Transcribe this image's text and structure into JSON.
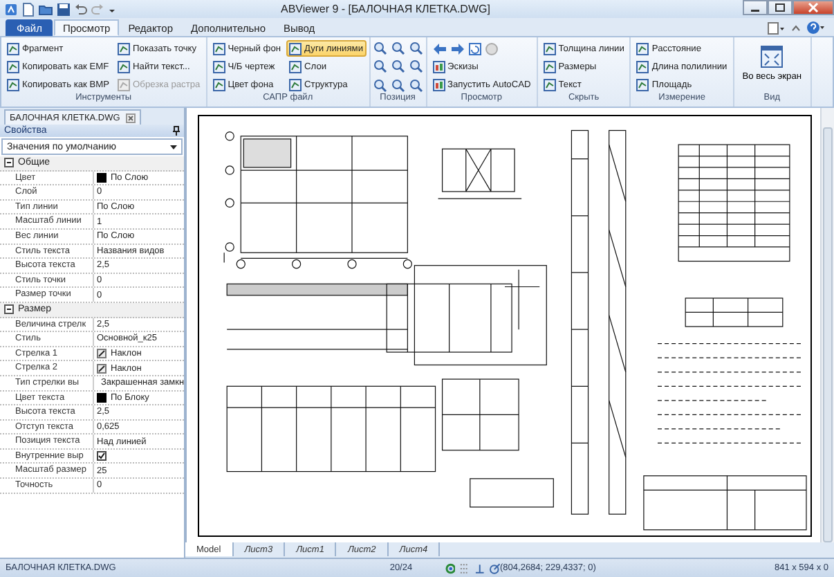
{
  "window": {
    "title": "ABViewer 9 - [БАЛОЧНАЯ КЛЕТКА.DWG]"
  },
  "ribbon_tabs": [
    {
      "label": "Файл",
      "kind": "file",
      "selected": false
    },
    {
      "label": "Просмотр",
      "kind": "tab",
      "selected": true
    },
    {
      "label": "Редактор",
      "kind": "tab",
      "selected": false
    },
    {
      "label": "Дополнительно",
      "kind": "tab",
      "selected": false
    },
    {
      "label": "Вывод",
      "kind": "tab",
      "selected": false
    }
  ],
  "ribbon_groups": [
    {
      "label": "Инструменты",
      "kind": "columns",
      "columns": [
        [
          {
            "label": "Фрагмент",
            "disabled": false,
            "on": false
          },
          {
            "label": "Копировать как EMF",
            "disabled": false,
            "on": false
          },
          {
            "label": "Копировать как BMP",
            "disabled": false,
            "on": false
          }
        ],
        [
          {
            "label": "Показать точку",
            "disabled": false,
            "on": false
          },
          {
            "label": "Найти текст...",
            "disabled": false,
            "on": false
          },
          {
            "label": "Обрезка растра",
            "disabled": true,
            "on": false
          }
        ]
      ]
    },
    {
      "label": "САПР файл",
      "kind": "columns",
      "columns": [
        [
          {
            "label": "Черный фон",
            "disabled": false,
            "on": false
          },
          {
            "label": "Ч/Б чертеж",
            "disabled": false,
            "on": false
          },
          {
            "label": "Цвет фона",
            "disabled": false,
            "on": false
          }
        ],
        [
          {
            "label": "Дуги линиями",
            "disabled": false,
            "on": true
          },
          {
            "label": "Слои",
            "disabled": false,
            "on": false
          },
          {
            "label": "Структура",
            "disabled": false,
            "on": false
          }
        ]
      ]
    },
    {
      "label": "Позиция",
      "kind": "zoom"
    },
    {
      "label": "Просмотр",
      "kind": "nav",
      "columns": [
        [
          {
            "label": "Эскизы",
            "disabled": false,
            "on": false
          },
          {
            "label": "Запустить AutoCAD",
            "disabled": false,
            "on": false
          }
        ]
      ]
    },
    {
      "label": "Скрыть",
      "kind": "columns",
      "columns": [
        [
          {
            "label": "Толщина линии",
            "disabled": false,
            "on": false
          },
          {
            "label": "Размеры",
            "disabled": false,
            "on": false
          },
          {
            "label": "Текст",
            "disabled": false,
            "on": false
          }
        ]
      ]
    },
    {
      "label": "Измерение",
      "kind": "columns",
      "columns": [
        [
          {
            "label": "Расстояние",
            "disabled": false,
            "on": false
          },
          {
            "label": "Длина полилинии",
            "disabled": false,
            "on": false
          },
          {
            "label": "Площадь",
            "disabled": false,
            "on": false
          }
        ]
      ]
    },
    {
      "label": "Вид",
      "kind": "big",
      "columns": [
        [
          {
            "label": "Во весь экран",
            "disabled": false,
            "on": false
          }
        ]
      ]
    }
  ],
  "document_tab": {
    "label": "БАЛОЧНАЯ КЛЕТКА.DWG"
  },
  "properties": {
    "title": "Свойства",
    "preset": "Значения по умолчанию",
    "categories": [
      {
        "label": "Общие",
        "expanded": true,
        "rows": [
          {
            "name": "Цвет",
            "value": "По Слою",
            "kind": "swatch"
          },
          {
            "name": "Слой",
            "value": "0",
            "kind": "text"
          },
          {
            "name": "Тип линии",
            "value": "По Слою",
            "kind": "text"
          },
          {
            "name": "Масштаб линии",
            "value": "1",
            "kind": "text"
          },
          {
            "name": "Вес линии",
            "value": "По Слою",
            "kind": "text"
          },
          {
            "name": "Стиль текста",
            "value": "Названия видов",
            "kind": "text"
          },
          {
            "name": "Высота текста",
            "value": "2,5",
            "kind": "text"
          },
          {
            "name": "Стиль точки",
            "value": "0",
            "kind": "text"
          },
          {
            "name": "Размер точки",
            "value": "0",
            "kind": "text"
          }
        ]
      },
      {
        "label": "Размер",
        "expanded": true,
        "rows": [
          {
            "name": "Величина стрелк",
            "value": "2,5",
            "kind": "text"
          },
          {
            "name": "Стиль",
            "value": "Основной_к25",
            "kind": "text"
          },
          {
            "name": "Стрелка 1",
            "value": "Наклон",
            "kind": "slash"
          },
          {
            "name": "Стрелка 2",
            "value": "Наклон",
            "kind": "slash"
          },
          {
            "name": "Тип стрелки вы",
            "value": "Закрашенная замкн",
            "kind": "arrow"
          },
          {
            "name": "Цвет текста",
            "value": "По Блоку",
            "kind": "swatch"
          },
          {
            "name": "Высота текста",
            "value": "2,5",
            "kind": "text"
          },
          {
            "name": "Отступ текста",
            "value": "0,625",
            "kind": "text"
          },
          {
            "name": "Позиция текста",
            "value": "Над линией",
            "kind": "text"
          },
          {
            "name": "Внутренние выр",
            "checked": true,
            "kind": "check"
          },
          {
            "name": "Масштаб размер",
            "value": "25",
            "kind": "text"
          },
          {
            "name": "Точность",
            "value": "0",
            "kind": "text"
          }
        ]
      }
    ]
  },
  "sheet_tabs": [
    {
      "label": "Model",
      "selected": true
    },
    {
      "label": "Лист3",
      "selected": false
    },
    {
      "label": "Лист1",
      "selected": false
    },
    {
      "label": "Лист2",
      "selected": false
    },
    {
      "label": "Лист4",
      "selected": false
    }
  ],
  "status_bar": {
    "file": "БАЛОЧНАЯ КЛЕТКА.DWG",
    "page": "20/24",
    "coordinates": "(804,2684; 229,4337; 0)",
    "size": "841 x 594 x 0"
  }
}
